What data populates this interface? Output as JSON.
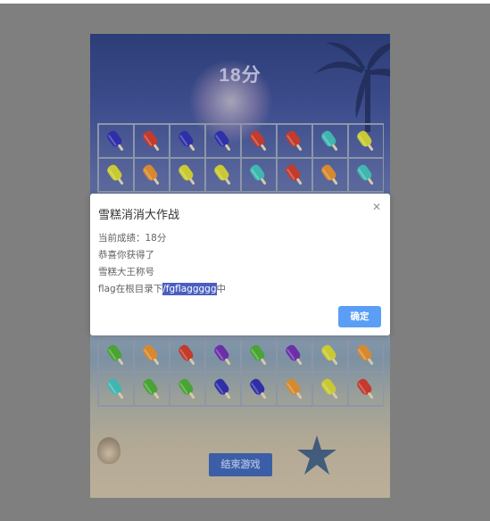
{
  "game": {
    "score_display": "18分",
    "end_button_label": "结束游戏",
    "grid_top": [
      [
        "blue",
        "red",
        "blue",
        "blue",
        "red",
        "red",
        "teal",
        "yellow"
      ],
      [
        "yellow",
        "orange",
        "yellow",
        "yellow",
        "teal",
        "red",
        "orange",
        "teal"
      ]
    ],
    "grid_bottom": [
      [
        "green",
        "orange",
        "red",
        "purple",
        "green",
        "purple",
        "yellow",
        "orange"
      ],
      [
        "teal",
        "green",
        "green",
        "blue",
        "blue",
        "orange",
        "yellow",
        "red"
      ]
    ],
    "colors": {
      "blue": "#2f2fa8",
      "red": "#c23b2c",
      "teal": "#3fb7b0",
      "yellow": "#c9c934",
      "orange": "#d6892f",
      "green": "#4aa335",
      "purple": "#6b2fa8"
    }
  },
  "dialog": {
    "title": "雪糕消消大作战",
    "close_icon": "close-icon",
    "line1": "当前成绩：18分",
    "line2": "恭喜你获得了",
    "line3": "雪糕大王称号",
    "line4_prefix": "flag在根目录下",
    "line4_highlight": "/fgflaggggg",
    "line4_suffix": "中",
    "ok_label": "确定"
  }
}
